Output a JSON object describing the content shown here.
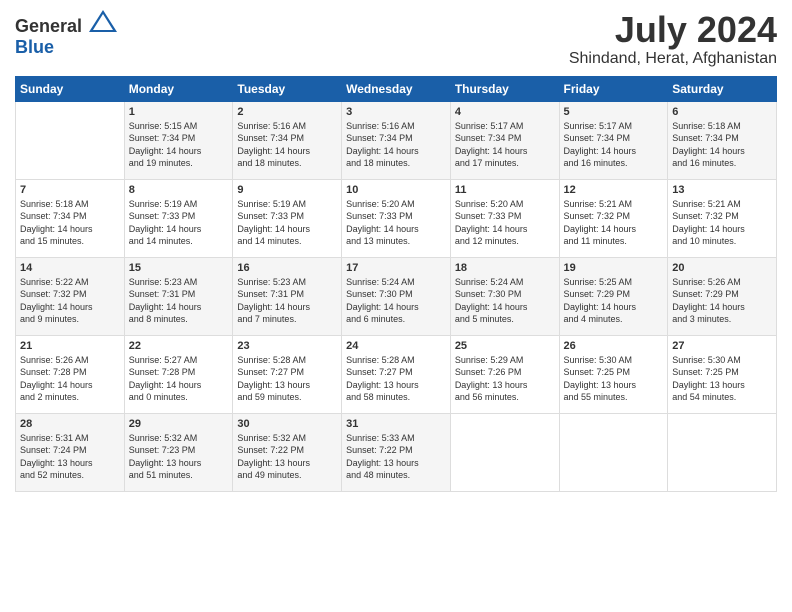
{
  "header": {
    "logo_general": "General",
    "logo_blue": "Blue",
    "title": "July 2024",
    "location": "Shindand, Herat, Afghanistan"
  },
  "weekdays": [
    "Sunday",
    "Monday",
    "Tuesday",
    "Wednesday",
    "Thursday",
    "Friday",
    "Saturday"
  ],
  "weeks": [
    [
      {
        "day": "",
        "sunrise": "",
        "sunset": "",
        "daylight": ""
      },
      {
        "day": "1",
        "sunrise": "Sunrise: 5:15 AM",
        "sunset": "Sunset: 7:34 PM",
        "daylight": "Daylight: 14 hours and 19 minutes."
      },
      {
        "day": "2",
        "sunrise": "Sunrise: 5:16 AM",
        "sunset": "Sunset: 7:34 PM",
        "daylight": "Daylight: 14 hours and 18 minutes."
      },
      {
        "day": "3",
        "sunrise": "Sunrise: 5:16 AM",
        "sunset": "Sunset: 7:34 PM",
        "daylight": "Daylight: 14 hours and 18 minutes."
      },
      {
        "day": "4",
        "sunrise": "Sunrise: 5:17 AM",
        "sunset": "Sunset: 7:34 PM",
        "daylight": "Daylight: 14 hours and 17 minutes."
      },
      {
        "day": "5",
        "sunrise": "Sunrise: 5:17 AM",
        "sunset": "Sunset: 7:34 PM",
        "daylight": "Daylight: 14 hours and 16 minutes."
      },
      {
        "day": "6",
        "sunrise": "Sunrise: 5:18 AM",
        "sunset": "Sunset: 7:34 PM",
        "daylight": "Daylight: 14 hours and 16 minutes."
      }
    ],
    [
      {
        "day": "7",
        "sunrise": "Sunrise: 5:18 AM",
        "sunset": "Sunset: 7:34 PM",
        "daylight": "Daylight: 14 hours and 15 minutes."
      },
      {
        "day": "8",
        "sunrise": "Sunrise: 5:19 AM",
        "sunset": "Sunset: 7:33 PM",
        "daylight": "Daylight: 14 hours and 14 minutes."
      },
      {
        "day": "9",
        "sunrise": "Sunrise: 5:19 AM",
        "sunset": "Sunset: 7:33 PM",
        "daylight": "Daylight: 14 hours and 14 minutes."
      },
      {
        "day": "10",
        "sunrise": "Sunrise: 5:20 AM",
        "sunset": "Sunset: 7:33 PM",
        "daylight": "Daylight: 14 hours and 13 minutes."
      },
      {
        "day": "11",
        "sunrise": "Sunrise: 5:20 AM",
        "sunset": "Sunset: 7:33 PM",
        "daylight": "Daylight: 14 hours and 12 minutes."
      },
      {
        "day": "12",
        "sunrise": "Sunrise: 5:21 AM",
        "sunset": "Sunset: 7:32 PM",
        "daylight": "Daylight: 14 hours and 11 minutes."
      },
      {
        "day": "13",
        "sunrise": "Sunrise: 5:21 AM",
        "sunset": "Sunset: 7:32 PM",
        "daylight": "Daylight: 14 hours and 10 minutes."
      }
    ],
    [
      {
        "day": "14",
        "sunrise": "Sunrise: 5:22 AM",
        "sunset": "Sunset: 7:32 PM",
        "daylight": "Daylight: 14 hours and 9 minutes."
      },
      {
        "day": "15",
        "sunrise": "Sunrise: 5:23 AM",
        "sunset": "Sunset: 7:31 PM",
        "daylight": "Daylight: 14 hours and 8 minutes."
      },
      {
        "day": "16",
        "sunrise": "Sunrise: 5:23 AM",
        "sunset": "Sunset: 7:31 PM",
        "daylight": "Daylight: 14 hours and 7 minutes."
      },
      {
        "day": "17",
        "sunrise": "Sunrise: 5:24 AM",
        "sunset": "Sunset: 7:30 PM",
        "daylight": "Daylight: 14 hours and 6 minutes."
      },
      {
        "day": "18",
        "sunrise": "Sunrise: 5:24 AM",
        "sunset": "Sunset: 7:30 PM",
        "daylight": "Daylight: 14 hours and 5 minutes."
      },
      {
        "day": "19",
        "sunrise": "Sunrise: 5:25 AM",
        "sunset": "Sunset: 7:29 PM",
        "daylight": "Daylight: 14 hours and 4 minutes."
      },
      {
        "day": "20",
        "sunrise": "Sunrise: 5:26 AM",
        "sunset": "Sunset: 7:29 PM",
        "daylight": "Daylight: 14 hours and 3 minutes."
      }
    ],
    [
      {
        "day": "21",
        "sunrise": "Sunrise: 5:26 AM",
        "sunset": "Sunset: 7:28 PM",
        "daylight": "Daylight: 14 hours and 2 minutes."
      },
      {
        "day": "22",
        "sunrise": "Sunrise: 5:27 AM",
        "sunset": "Sunset: 7:28 PM",
        "daylight": "Daylight: 14 hours and 0 minutes."
      },
      {
        "day": "23",
        "sunrise": "Sunrise: 5:28 AM",
        "sunset": "Sunset: 7:27 PM",
        "daylight": "Daylight: 13 hours and 59 minutes."
      },
      {
        "day": "24",
        "sunrise": "Sunrise: 5:28 AM",
        "sunset": "Sunset: 7:27 PM",
        "daylight": "Daylight: 13 hours and 58 minutes."
      },
      {
        "day": "25",
        "sunrise": "Sunrise: 5:29 AM",
        "sunset": "Sunset: 7:26 PM",
        "daylight": "Daylight: 13 hours and 56 minutes."
      },
      {
        "day": "26",
        "sunrise": "Sunrise: 5:30 AM",
        "sunset": "Sunset: 7:25 PM",
        "daylight": "Daylight: 13 hours and 55 minutes."
      },
      {
        "day": "27",
        "sunrise": "Sunrise: 5:30 AM",
        "sunset": "Sunset: 7:25 PM",
        "daylight": "Daylight: 13 hours and 54 minutes."
      }
    ],
    [
      {
        "day": "28",
        "sunrise": "Sunrise: 5:31 AM",
        "sunset": "Sunset: 7:24 PM",
        "daylight": "Daylight: 13 hours and 52 minutes."
      },
      {
        "day": "29",
        "sunrise": "Sunrise: 5:32 AM",
        "sunset": "Sunset: 7:23 PM",
        "daylight": "Daylight: 13 hours and 51 minutes."
      },
      {
        "day": "30",
        "sunrise": "Sunrise: 5:32 AM",
        "sunset": "Sunset: 7:22 PM",
        "daylight": "Daylight: 13 hours and 49 minutes."
      },
      {
        "day": "31",
        "sunrise": "Sunrise: 5:33 AM",
        "sunset": "Sunset: 7:22 PM",
        "daylight": "Daylight: 13 hours and 48 minutes."
      },
      {
        "day": "",
        "sunrise": "",
        "sunset": "",
        "daylight": ""
      },
      {
        "day": "",
        "sunrise": "",
        "sunset": "",
        "daylight": ""
      },
      {
        "day": "",
        "sunrise": "",
        "sunset": "",
        "daylight": ""
      }
    ]
  ]
}
